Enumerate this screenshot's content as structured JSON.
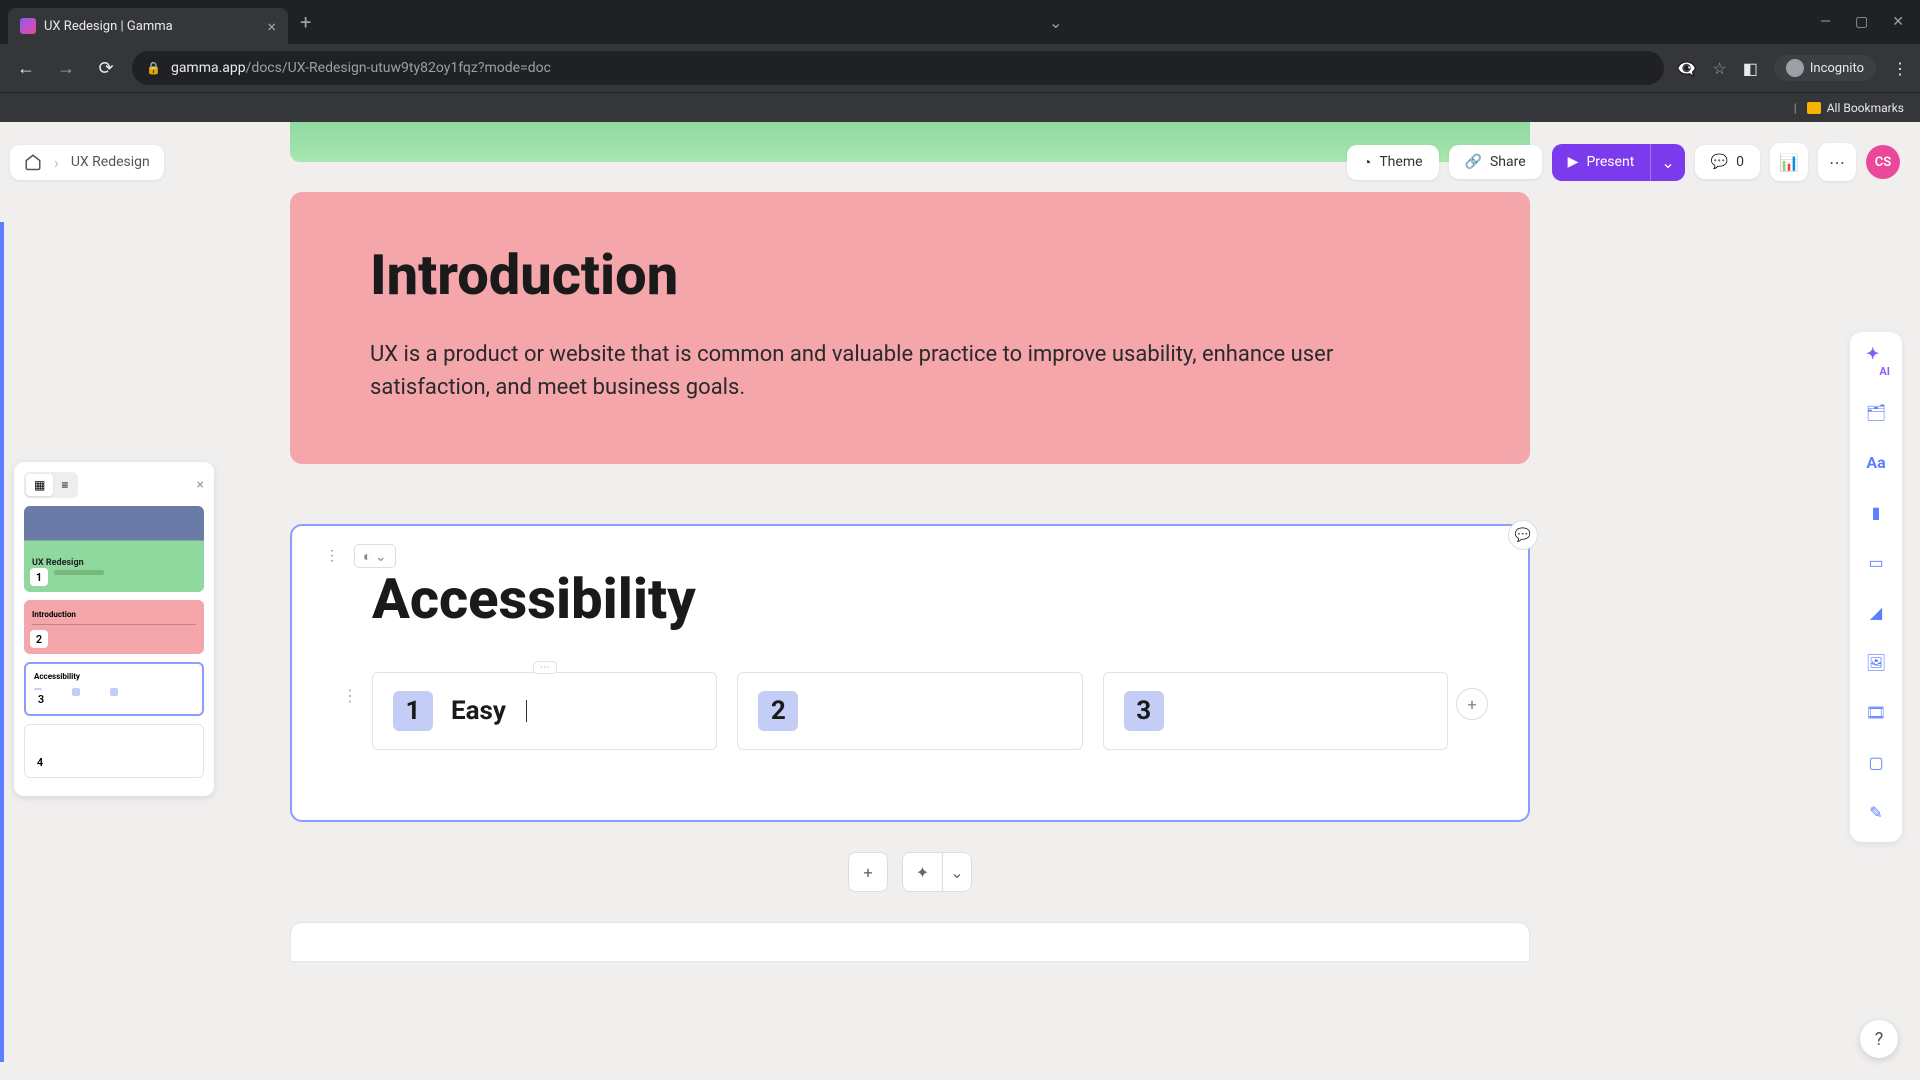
{
  "browser": {
    "tab_title": "UX Redesign | Gamma",
    "url_domain": "gamma.app",
    "url_path": "/docs/UX-Redesign-utuw9ty82oy1fqz?mode=doc",
    "incognito_label": "Incognito",
    "bookmarks_label": "All Bookmarks"
  },
  "breadcrumb": {
    "doc_title": "UX Redesign"
  },
  "toolbar": {
    "theme_label": "Theme",
    "share_label": "Share",
    "present_label": "Present",
    "comment_count": "0",
    "avatar_initials": "CS"
  },
  "slides": [
    {
      "num": "1",
      "title": "UX Redesign"
    },
    {
      "num": "2",
      "title": "Introduction"
    },
    {
      "num": "3",
      "title": "Accessibility"
    },
    {
      "num": "4",
      "title": ""
    }
  ],
  "card_intro": {
    "heading": "Introduction",
    "body": "UX is a product or website that is common and valuable practice to improve usability, enhance user satisfaction, and meet business goals."
  },
  "card_access": {
    "heading": "Accessibility",
    "steps": [
      {
        "num": "1",
        "text": "Easy"
      },
      {
        "num": "2",
        "text": ""
      },
      {
        "num": "3",
        "text": ""
      }
    ]
  },
  "right_rail": {
    "ai_label": "AI"
  }
}
